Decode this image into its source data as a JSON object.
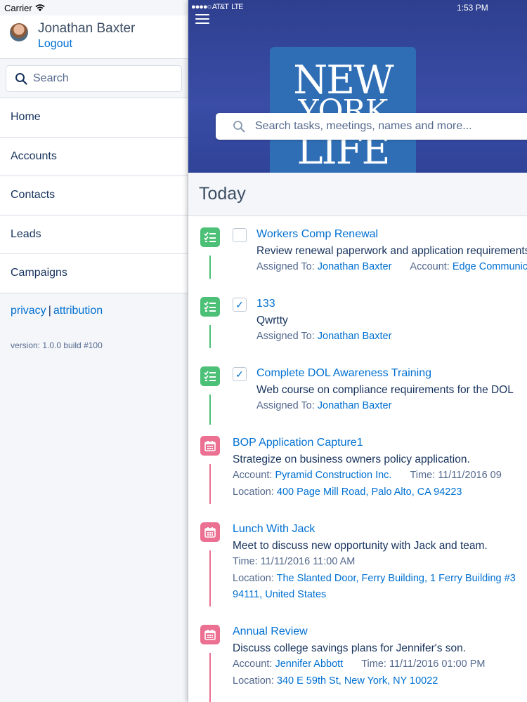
{
  "sidebar": {
    "carrier": "Carrier",
    "user_name": "Jonathan Baxter",
    "logout_label": "Logout",
    "search_placeholder": "Search",
    "nav": [
      {
        "label": "Home"
      },
      {
        "label": "Accounts"
      },
      {
        "label": "Contacts"
      },
      {
        "label": "Leads"
      },
      {
        "label": "Campaigns"
      }
    ],
    "privacy_label": "privacy",
    "separator": "|",
    "attribution_label": "attribution",
    "version": "version: 1.0.0 build #100"
  },
  "main": {
    "status": {
      "signal": "●●●●○",
      "carrier": "AT&T",
      "network": "LTE",
      "time": "1:53 PM"
    },
    "logo": {
      "line1": "NEW",
      "line2": "YORK",
      "line3": "LIFE"
    },
    "search_placeholder": "Search tasks, meetings, names and more...",
    "section_title": "Today",
    "tasks": [
      {
        "title": "Workers Comp Renewal",
        "checked": false,
        "description": "Review renewal paperwork and application requirements",
        "assigned_label": "Assigned To:",
        "assigned_to": "Jonathan Baxter",
        "account_label": "Account:",
        "account": "Edge Communications"
      },
      {
        "title": "133",
        "checked": true,
        "description": "Qwrtty",
        "assigned_label": "Assigned To:",
        "assigned_to": "Jonathan Baxter"
      },
      {
        "title": "Complete DOL Awareness Training",
        "checked": true,
        "description": "Web course on compliance requirements for the DOL",
        "assigned_label": "Assigned To:",
        "assigned_to": "Jonathan Baxter"
      }
    ],
    "events": [
      {
        "title": "BOP Application Capture1",
        "description": "Strategize on business owners policy application.",
        "account_label": "Account:",
        "account": "Pyramid Construction Inc.",
        "time_label": "Time:",
        "time": "11/11/2016 09",
        "location_label": "Location:",
        "location": "400 Page Mill Road, Palo Alto, CA 94223"
      },
      {
        "title": "Lunch With Jack",
        "description": "Meet to discuss new opportunity with Jack and team.",
        "time_label": "Time:",
        "time": "11/11/2016 11:00 AM",
        "location_label": "Location:",
        "location": "The Slanted Door, Ferry Building, 1 Ferry Building #3",
        "location_line2": "94111, United States"
      },
      {
        "title": "Annual Review",
        "description": "Discuss college savings plans for Jennifer's son.",
        "account_label": "Account:",
        "account": "Jennifer Abbott",
        "time_label": "Time:",
        "time": "11/11/2016 01:00 PM",
        "location_label": "Location:",
        "location": "340 E 59th St, New York, NY 10022"
      }
    ]
  },
  "colors": {
    "link": "#0070d2",
    "task": "#4bc076",
    "event": "#eb7092",
    "hero": "#3a4da6"
  }
}
